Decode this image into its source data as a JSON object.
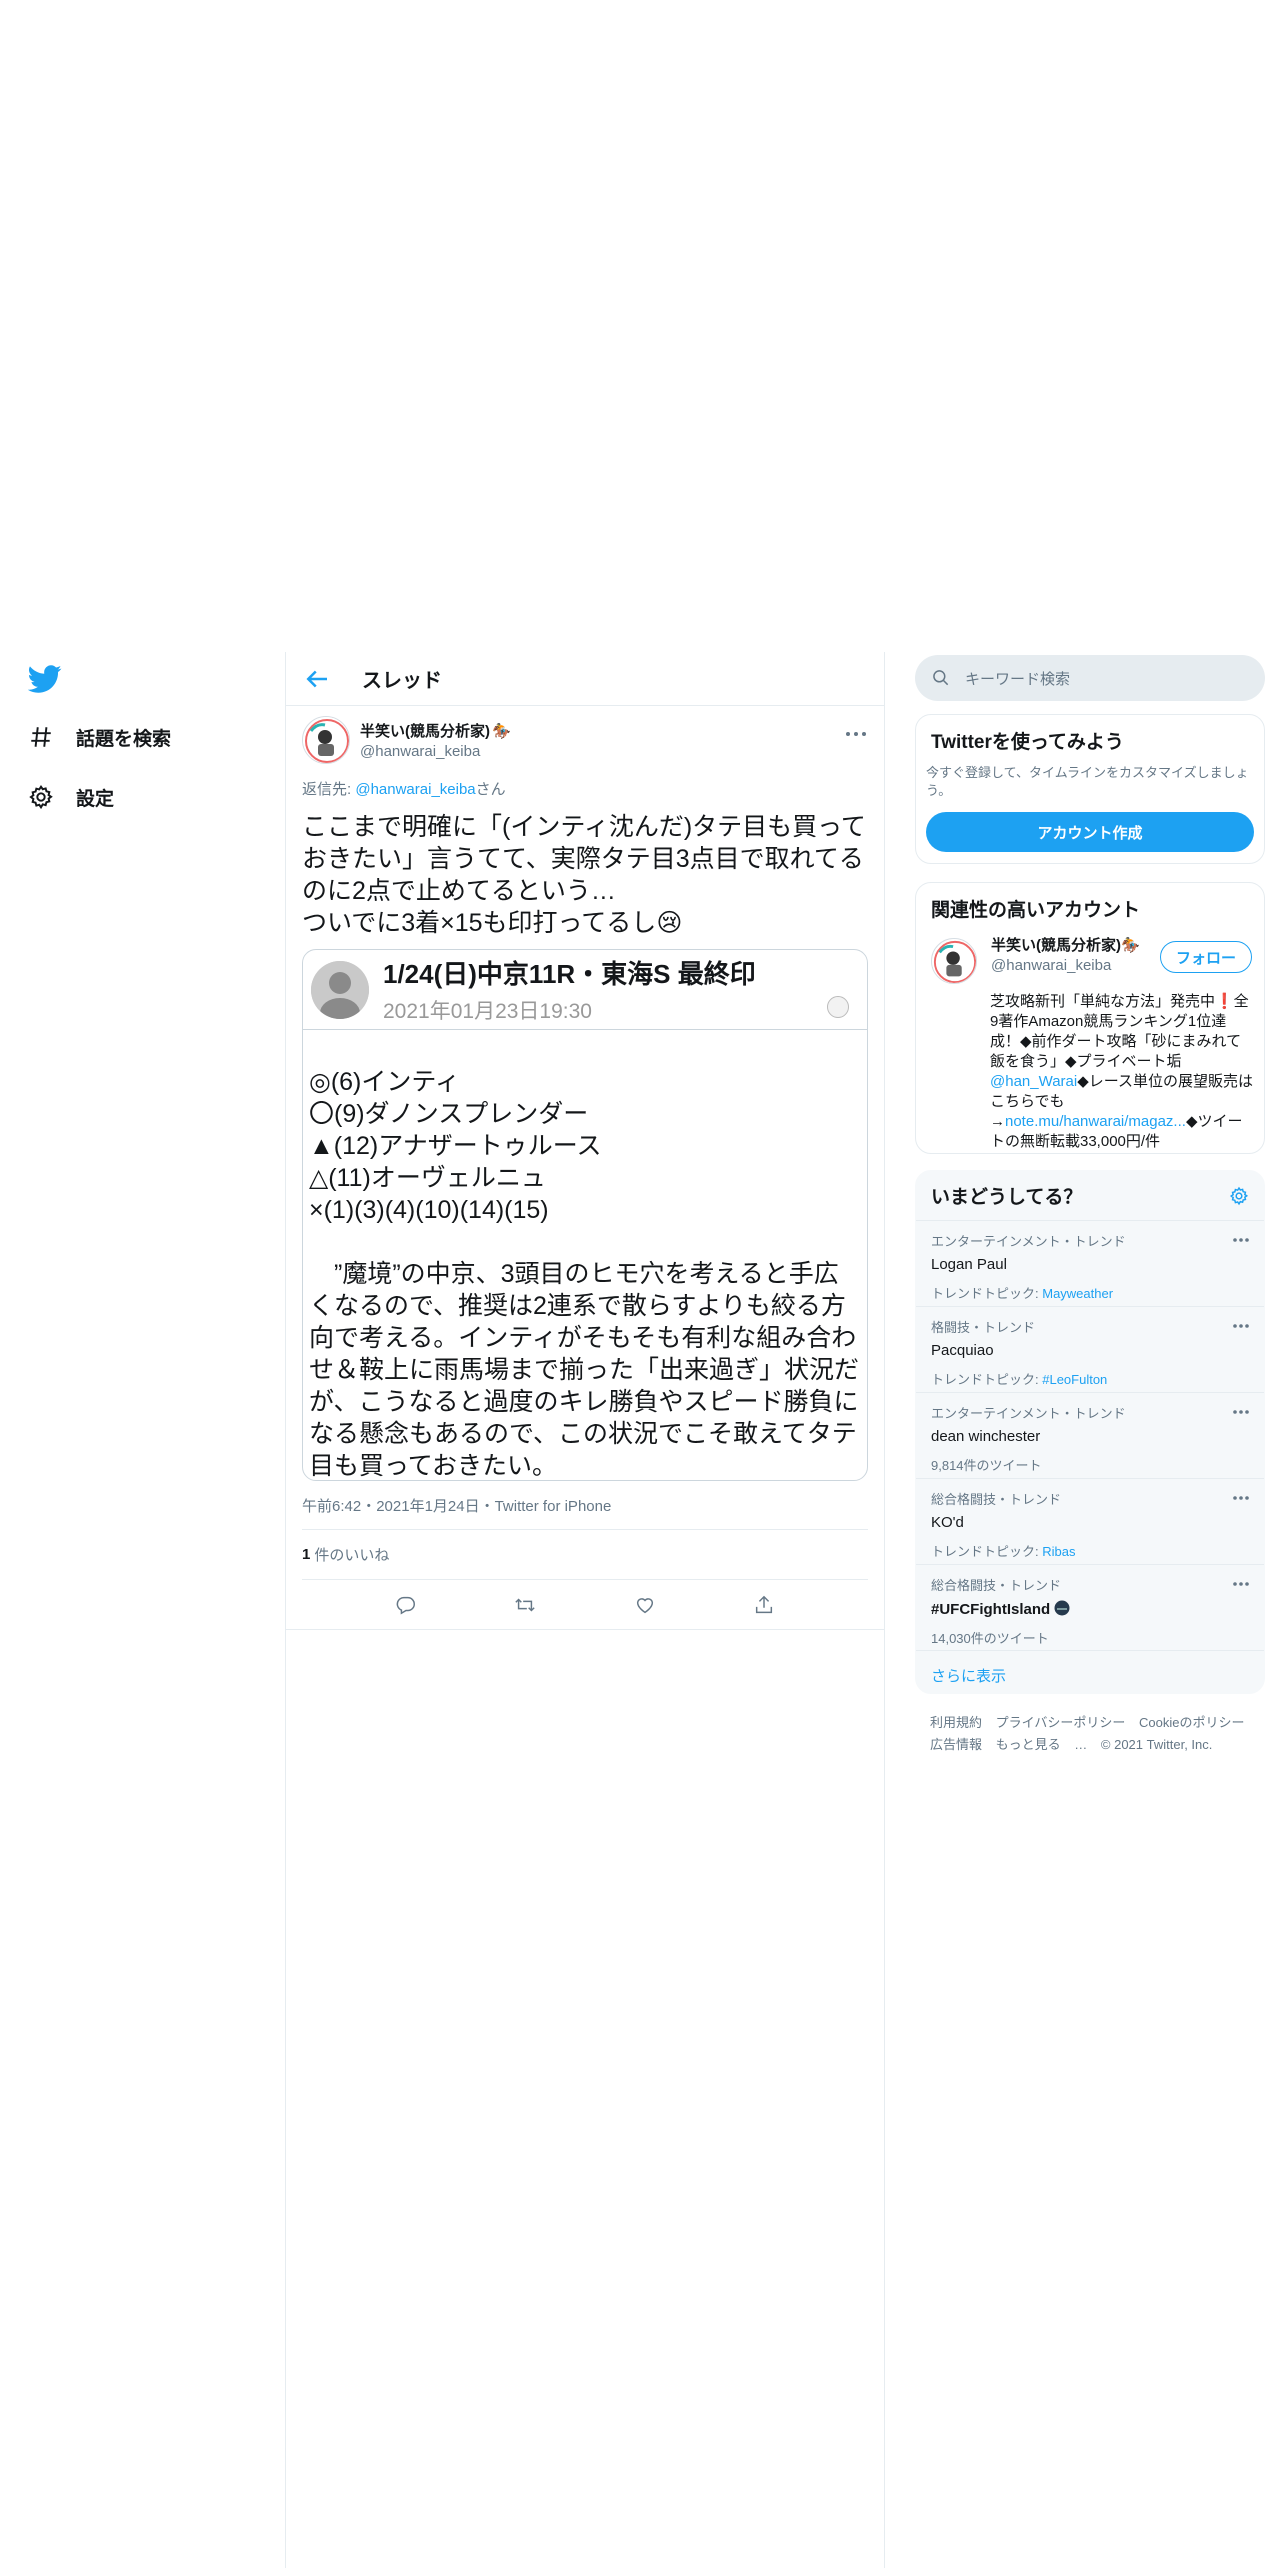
{
  "nav": {
    "items": [
      {
        "label": "話題を検索",
        "icon": "hashtag-icon"
      },
      {
        "label": "設定",
        "icon": "gear-icon"
      }
    ]
  },
  "header": {
    "title": "スレッド"
  },
  "tweet": {
    "author_name": "半笑い(競馬分析家)",
    "author_emoji": "🏇",
    "handle": "@hanwarai_keiba",
    "reply_prefix": "返信先: ",
    "reply_handle": "@hanwarai_keiba",
    "reply_suffix": "さん",
    "text_main": "ここまで明確に「(インティ沈んだ)タテ目も買っておきたい」言うてて、実際タテ目3点目で取れてるのに2点で止めてるという…\nついでに3着×15も印打ってるし",
    "text_emoji": "😢",
    "card": {
      "title": "1/24(日)中京11R・東海S 最終印",
      "date": "2021年01月23日19:30",
      "body": "◎(6)インティ\n〇(9)ダノンスプレンダー\n▲(12)アナザートゥルース\n△(11)オーヴェルニュ\n×(1)(3)(4)(10)(14)(15)\n\n　”魔境”の中京、3頭目のヒモ穴を考えると手広くなるので、推奨は2連系で散らすよりも絞る方向で考える。インティがそもそも有利な組み合わせ＆鞍上に雨馬場まで揃った「出来過ぎ」状況だが、こうなると過度のキレ勝負やスピード勝負になる懸念もあるので、この状況でこそ敢えてタテ目も買っておきたい。"
    },
    "meta": "午前6:42・2021年1月24日・Twitter for iPhone",
    "likes_count": "1",
    "likes_label": "件のいいね"
  },
  "search": {
    "placeholder": "キーワード検索"
  },
  "signup": {
    "title": "Twitterを使ってみよう",
    "desc": "今すぐ登録して、タイムラインをカスタマイズしましょう。",
    "button": "アカウント作成"
  },
  "related": {
    "title": "関連性の高いアカウント",
    "name": "半笑い(競馬分析家)",
    "emoji": "🏇",
    "handle": "@hanwarai_keiba",
    "follow": "フォロー",
    "bio_1": "芝攻略新刊「単純な方法」発売中❗全9著作Amazon競馬ランキング1位達成！◆前作ダート攻略「砂にまみれて飯を食う」◆プライベート垢",
    "bio_link_1": "@han_Warai",
    "bio_2": "◆レース単位の展望販売はこちらでも→",
    "bio_link_2": "note.mu/hanwarai/magaz...",
    "bio_3": "◆ツイートの無断転載33,000円/件"
  },
  "trends": {
    "title": "いまどうしてる？",
    "items": [
      {
        "cat": "エンターテインメント・トレンド",
        "name": "Logan Paul",
        "sub_label": "トレンドトピック: ",
        "sub_link": "Mayweather",
        "sub_plain": ""
      },
      {
        "cat": "格闘技・トレンド",
        "name": "Pacquiao",
        "sub_label": "トレンドトピック: ",
        "sub_link": "#LeoFulton",
        "sub_plain": ""
      },
      {
        "cat": "エンターテインメント・トレンド",
        "name": "dean winchester",
        "sub_label": "",
        "sub_link": "",
        "sub_plain": "9,814件のツイート"
      },
      {
        "cat": "総合格闘技・トレンド",
        "name": "KO'd",
        "sub_label": "トレンドトピック: ",
        "sub_link": "Ribas",
        "sub_plain": ""
      },
      {
        "cat": "総合格闘技・トレンド",
        "name": "#UFCFightIsland",
        "sub_label": "",
        "sub_link": "",
        "sub_plain": "14,030件のツイート"
      }
    ],
    "more": "さらに表示"
  },
  "footer": {
    "links": [
      "利用規約",
      "プライバシーポリシー",
      "Cookieのポリシー",
      "広告情報",
      "もっと見る"
    ],
    "copyright": "© 2021 Twitter, Inc."
  },
  "colors": {
    "accent": "#1da1f2",
    "text": "#14171a",
    "muted": "#657786",
    "border": "#e6ecf0"
  }
}
